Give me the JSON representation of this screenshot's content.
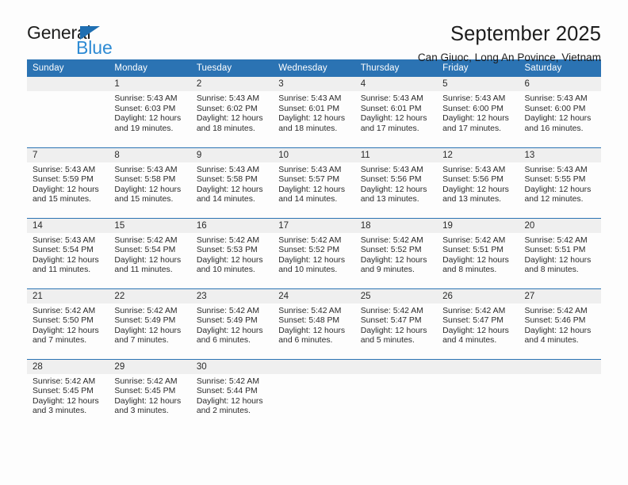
{
  "brand": {
    "name_top": "General",
    "name_bottom": "Blue",
    "triangle_color": "#1f6fb2",
    "blue_text_color": "#2e8bd4"
  },
  "header": {
    "title": "September 2025",
    "subtitle": "Can Giuoc, Long An Povince, Vietnam"
  },
  "colors": {
    "header_blue": "#2b73b3",
    "daynum_band": "#efefef",
    "grid_line": "#2b73b3",
    "page_background": "#fdfdfd",
    "text": "#2b2b2b"
  },
  "labels": {
    "sunrise_prefix": "Sunrise:",
    "sunset_prefix": "Sunset:",
    "daylight_prefix": "Daylight:"
  },
  "calendar": {
    "weekday_headers": [
      "Sunday",
      "Monday",
      "Tuesday",
      "Wednesday",
      "Thursday",
      "Friday",
      "Saturday"
    ],
    "weeks": [
      [
        {
          "day": "",
          "empty": true
        },
        {
          "day": "1",
          "sunrise": "Sunrise: 5:43 AM",
          "sunset": "Sunset: 6:03 PM",
          "daylight_l1": "Daylight: 12 hours",
          "daylight_l2": "and 19 minutes."
        },
        {
          "day": "2",
          "sunrise": "Sunrise: 5:43 AM",
          "sunset": "Sunset: 6:02 PM",
          "daylight_l1": "Daylight: 12 hours",
          "daylight_l2": "and 18 minutes."
        },
        {
          "day": "3",
          "sunrise": "Sunrise: 5:43 AM",
          "sunset": "Sunset: 6:01 PM",
          "daylight_l1": "Daylight: 12 hours",
          "daylight_l2": "and 18 minutes."
        },
        {
          "day": "4",
          "sunrise": "Sunrise: 5:43 AM",
          "sunset": "Sunset: 6:01 PM",
          "daylight_l1": "Daylight: 12 hours",
          "daylight_l2": "and 17 minutes."
        },
        {
          "day": "5",
          "sunrise": "Sunrise: 5:43 AM",
          "sunset": "Sunset: 6:00 PM",
          "daylight_l1": "Daylight: 12 hours",
          "daylight_l2": "and 17 minutes."
        },
        {
          "day": "6",
          "sunrise": "Sunrise: 5:43 AM",
          "sunset": "Sunset: 6:00 PM",
          "daylight_l1": "Daylight: 12 hours",
          "daylight_l2": "and 16 minutes."
        }
      ],
      [
        {
          "day": "7",
          "sunrise": "Sunrise: 5:43 AM",
          "sunset": "Sunset: 5:59 PM",
          "daylight_l1": "Daylight: 12 hours",
          "daylight_l2": "and 15 minutes."
        },
        {
          "day": "8",
          "sunrise": "Sunrise: 5:43 AM",
          "sunset": "Sunset: 5:58 PM",
          "daylight_l1": "Daylight: 12 hours",
          "daylight_l2": "and 15 minutes."
        },
        {
          "day": "9",
          "sunrise": "Sunrise: 5:43 AM",
          "sunset": "Sunset: 5:58 PM",
          "daylight_l1": "Daylight: 12 hours",
          "daylight_l2": "and 14 minutes."
        },
        {
          "day": "10",
          "sunrise": "Sunrise: 5:43 AM",
          "sunset": "Sunset: 5:57 PM",
          "daylight_l1": "Daylight: 12 hours",
          "daylight_l2": "and 14 minutes."
        },
        {
          "day": "11",
          "sunrise": "Sunrise: 5:43 AM",
          "sunset": "Sunset: 5:56 PM",
          "daylight_l1": "Daylight: 12 hours",
          "daylight_l2": "and 13 minutes."
        },
        {
          "day": "12",
          "sunrise": "Sunrise: 5:43 AM",
          "sunset": "Sunset: 5:56 PM",
          "daylight_l1": "Daylight: 12 hours",
          "daylight_l2": "and 13 minutes."
        },
        {
          "day": "13",
          "sunrise": "Sunrise: 5:43 AM",
          "sunset": "Sunset: 5:55 PM",
          "daylight_l1": "Daylight: 12 hours",
          "daylight_l2": "and 12 minutes."
        }
      ],
      [
        {
          "day": "14",
          "sunrise": "Sunrise: 5:43 AM",
          "sunset": "Sunset: 5:54 PM",
          "daylight_l1": "Daylight: 12 hours",
          "daylight_l2": "and 11 minutes."
        },
        {
          "day": "15",
          "sunrise": "Sunrise: 5:42 AM",
          "sunset": "Sunset: 5:54 PM",
          "daylight_l1": "Daylight: 12 hours",
          "daylight_l2": "and 11 minutes."
        },
        {
          "day": "16",
          "sunrise": "Sunrise: 5:42 AM",
          "sunset": "Sunset: 5:53 PM",
          "daylight_l1": "Daylight: 12 hours",
          "daylight_l2": "and 10 minutes."
        },
        {
          "day": "17",
          "sunrise": "Sunrise: 5:42 AM",
          "sunset": "Sunset: 5:52 PM",
          "daylight_l1": "Daylight: 12 hours",
          "daylight_l2": "and 10 minutes."
        },
        {
          "day": "18",
          "sunrise": "Sunrise: 5:42 AM",
          "sunset": "Sunset: 5:52 PM",
          "daylight_l1": "Daylight: 12 hours",
          "daylight_l2": "and 9 minutes."
        },
        {
          "day": "19",
          "sunrise": "Sunrise: 5:42 AM",
          "sunset": "Sunset: 5:51 PM",
          "daylight_l1": "Daylight: 12 hours",
          "daylight_l2": "and 8 minutes."
        },
        {
          "day": "20",
          "sunrise": "Sunrise: 5:42 AM",
          "sunset": "Sunset: 5:51 PM",
          "daylight_l1": "Daylight: 12 hours",
          "daylight_l2": "and 8 minutes."
        }
      ],
      [
        {
          "day": "21",
          "sunrise": "Sunrise: 5:42 AM",
          "sunset": "Sunset: 5:50 PM",
          "daylight_l1": "Daylight: 12 hours",
          "daylight_l2": "and 7 minutes."
        },
        {
          "day": "22",
          "sunrise": "Sunrise: 5:42 AM",
          "sunset": "Sunset: 5:49 PM",
          "daylight_l1": "Daylight: 12 hours",
          "daylight_l2": "and 7 minutes."
        },
        {
          "day": "23",
          "sunrise": "Sunrise: 5:42 AM",
          "sunset": "Sunset: 5:49 PM",
          "daylight_l1": "Daylight: 12 hours",
          "daylight_l2": "and 6 minutes."
        },
        {
          "day": "24",
          "sunrise": "Sunrise: 5:42 AM",
          "sunset": "Sunset: 5:48 PM",
          "daylight_l1": "Daylight: 12 hours",
          "daylight_l2": "and 6 minutes."
        },
        {
          "day": "25",
          "sunrise": "Sunrise: 5:42 AM",
          "sunset": "Sunset: 5:47 PM",
          "daylight_l1": "Daylight: 12 hours",
          "daylight_l2": "and 5 minutes."
        },
        {
          "day": "26",
          "sunrise": "Sunrise: 5:42 AM",
          "sunset": "Sunset: 5:47 PM",
          "daylight_l1": "Daylight: 12 hours",
          "daylight_l2": "and 4 minutes."
        },
        {
          "day": "27",
          "sunrise": "Sunrise: 5:42 AM",
          "sunset": "Sunset: 5:46 PM",
          "daylight_l1": "Daylight: 12 hours",
          "daylight_l2": "and 4 minutes."
        }
      ],
      [
        {
          "day": "28",
          "sunrise": "Sunrise: 5:42 AM",
          "sunset": "Sunset: 5:45 PM",
          "daylight_l1": "Daylight: 12 hours",
          "daylight_l2": "and 3 minutes."
        },
        {
          "day": "29",
          "sunrise": "Sunrise: 5:42 AM",
          "sunset": "Sunset: 5:45 PM",
          "daylight_l1": "Daylight: 12 hours",
          "daylight_l2": "and 3 minutes."
        },
        {
          "day": "30",
          "sunrise": "Sunrise: 5:42 AM",
          "sunset": "Sunset: 5:44 PM",
          "daylight_l1": "Daylight: 12 hours",
          "daylight_l2": "and 2 minutes."
        },
        {
          "day": "",
          "empty": true
        },
        {
          "day": "",
          "empty": true
        },
        {
          "day": "",
          "empty": true
        },
        {
          "day": "",
          "empty": true
        }
      ]
    ]
  }
}
